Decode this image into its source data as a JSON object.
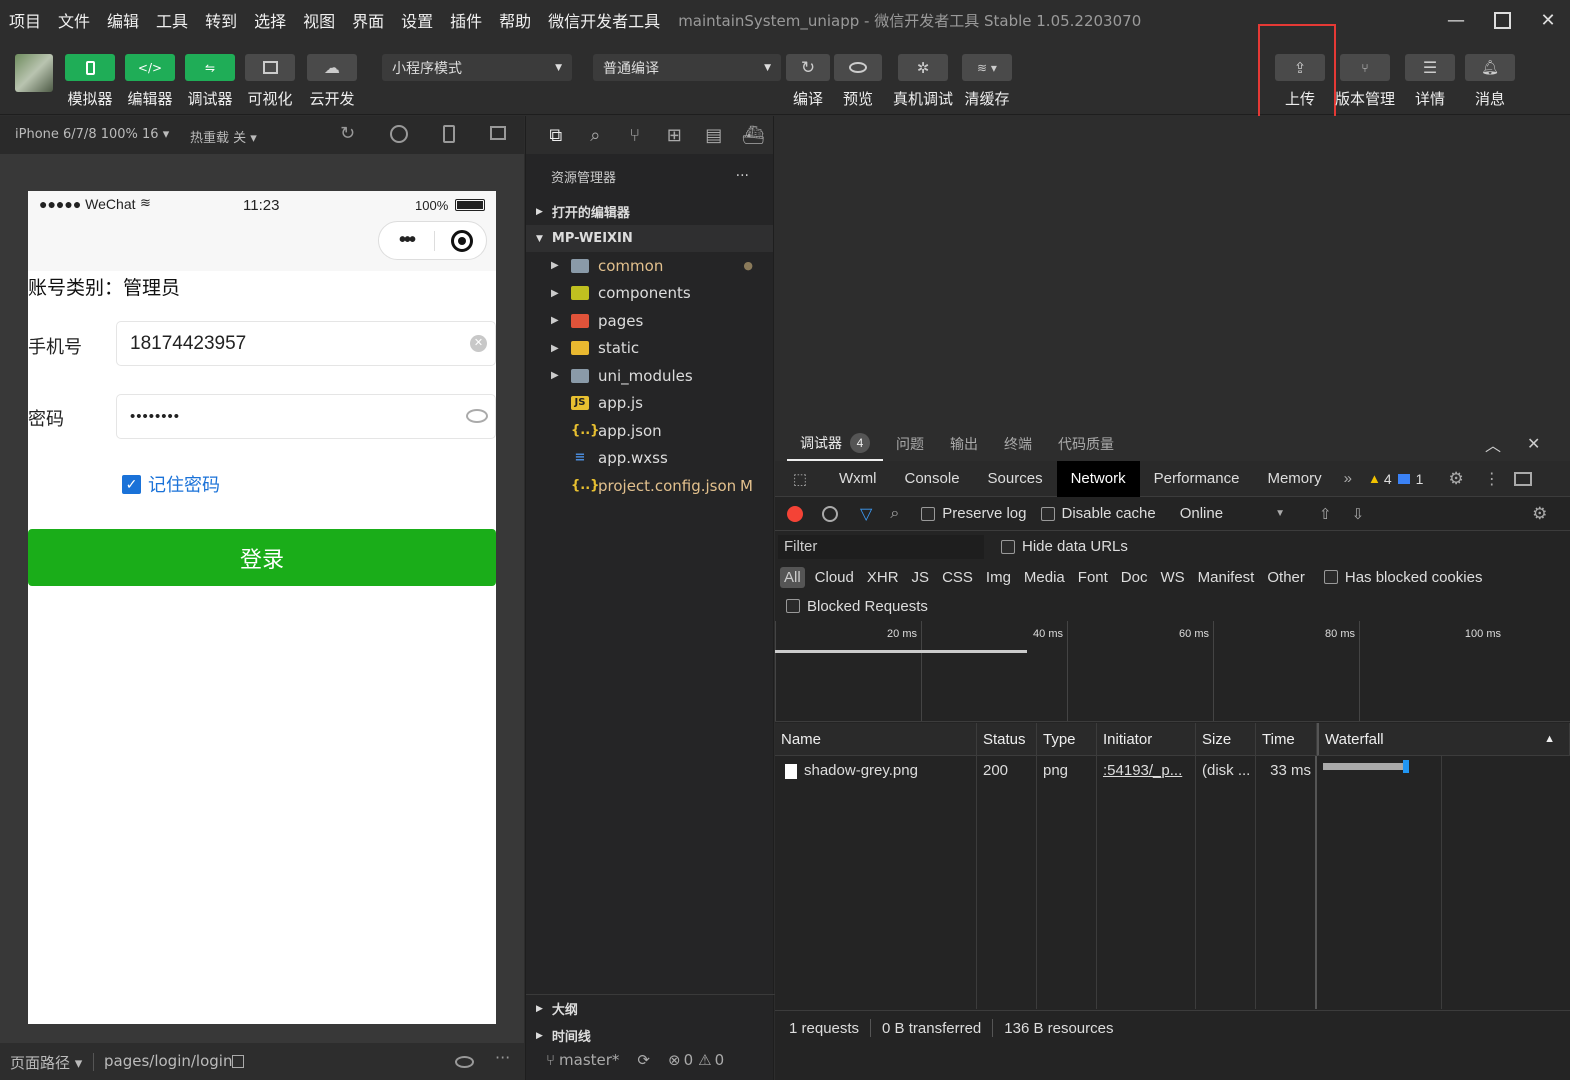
{
  "menu": {
    "items": [
      "项目",
      "文件",
      "编辑",
      "工具",
      "转到",
      "选择",
      "视图",
      "界面",
      "设置",
      "插件",
      "帮助",
      "微信开发者工具"
    ],
    "title": "maintainSystem_uniapp - 微信开发者工具 Stable 1.05.2203070"
  },
  "toolbar": {
    "simulator": "模拟器",
    "editor": "编辑器",
    "debugger": "调试器",
    "visual": "可视化",
    "cloud": "云开发",
    "mode": "小程序模式",
    "compile_mode": "普通编译",
    "compile": "编译",
    "preview": "预览",
    "remote_debug": "真机调试",
    "clear_cache": "清缓存",
    "upload": "上传",
    "version": "版本管理",
    "details": "详情",
    "messages": "消息"
  },
  "simulator": {
    "device": "iPhone 6/7/8 100% 16 ▾",
    "hot_reload": "热重载 关 ▾",
    "status": {
      "carrier": "●●●●● WeChat",
      "time": "11:23",
      "battery": "100%"
    },
    "page": {
      "account_label": "账号类别：",
      "account_value": "管理员",
      "phone_label": "手机号",
      "phone_value": "18174423957",
      "password_label": "密码",
      "password_value": "••••••••",
      "remember": "记住密码",
      "login": "登录"
    },
    "footer": {
      "path_label": "页面路径 ▾",
      "path": "pages/login/login"
    }
  },
  "explorer": {
    "title": "资源管理器",
    "open_editors": "打开的编辑器",
    "project": "MP-WEIXIN",
    "files": [
      {
        "name": "common",
        "type": "folder",
        "color": "#8a9aa8",
        "modified": "●"
      },
      {
        "name": "components",
        "type": "folder",
        "color": "#c0c020",
        "modified": ""
      },
      {
        "name": "pages",
        "type": "folder",
        "color": "#e0533a",
        "modified": ""
      },
      {
        "name": "static",
        "type": "folder",
        "color": "#e8b830",
        "modified": ""
      },
      {
        "name": "uni_modules",
        "type": "folder",
        "color": "#8a9aa8",
        "modified": ""
      },
      {
        "name": "app.js",
        "type": "js",
        "color": "#e8c030",
        "modified": ""
      },
      {
        "name": "app.json",
        "type": "json",
        "color": "#e8c030",
        "modified": ""
      },
      {
        "name": "app.wxss",
        "type": "wxss",
        "color": "#4a8ad8",
        "modified": ""
      },
      {
        "name": "project.config.json",
        "type": "json",
        "color": "#e8c030",
        "modified": "M"
      }
    ],
    "outline": "大纲",
    "timeline": "时间线",
    "branch": "master*",
    "errors": "0",
    "warnings": "0"
  },
  "devtools": {
    "tabs": [
      "调试器",
      "问题",
      "输出",
      "终端",
      "代码质量"
    ],
    "debugger_badge": "4",
    "panels": [
      "Wxml",
      "Console",
      "Sources",
      "Network",
      "Performance",
      "Memory"
    ],
    "active_panel": "Network",
    "warn_count": "4",
    "info_count": "1",
    "preserve_log": "Preserve log",
    "disable_cache": "Disable cache",
    "throttle": "Online",
    "filter_placeholder": "Filter",
    "hide_data_urls": "Hide data URLs",
    "types": [
      "All",
      "Cloud",
      "XHR",
      "JS",
      "CSS",
      "Img",
      "Media",
      "Font",
      "Doc",
      "WS",
      "Manifest",
      "Other"
    ],
    "blocked_cookies": "Has blocked cookies",
    "blocked_requests": "Blocked Requests",
    "ticks": [
      "20 ms",
      "40 ms",
      "60 ms",
      "80 ms",
      "100 ms"
    ],
    "columns": [
      "Name",
      "Status",
      "Type",
      "Initiator",
      "Size",
      "Time",
      "Waterfall"
    ],
    "rows": [
      {
        "name": "shadow-grey.png",
        "status": "200",
        "type": "png",
        "initiator": ":54193/_p...",
        "size": "(disk ...",
        "time": "33 ms"
      }
    ],
    "summary": {
      "requests": "1 requests",
      "transferred": "0 B transferred",
      "resources": "136 B resources"
    }
  },
  "colors": {
    "accent_green": "#1fad57",
    "login_green": "#1aad19",
    "link_blue": "#1a72d8",
    "highlight_red": "#e53935"
  }
}
